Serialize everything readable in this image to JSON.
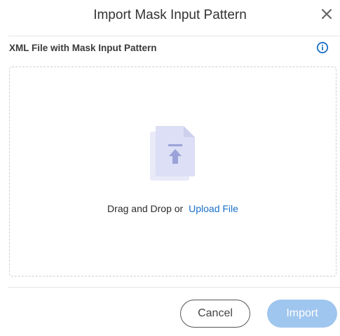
{
  "dialog": {
    "title": "Import Mask Input Pattern",
    "close_icon": "close-icon",
    "section_label": "XML File with Mask Input Pattern",
    "info_icon": "info-icon"
  },
  "dropzone": {
    "illustration_icon": "file-upload-icon",
    "drag_text": "Drag and Drop or",
    "upload_link": "Upload File"
  },
  "footer": {
    "cancel_label": "Cancel",
    "import_label": "Import"
  },
  "colors": {
    "accent": "#1a6fc9",
    "import_button_disabled": "#9fc6ee",
    "illustration": "#dcdff5"
  }
}
